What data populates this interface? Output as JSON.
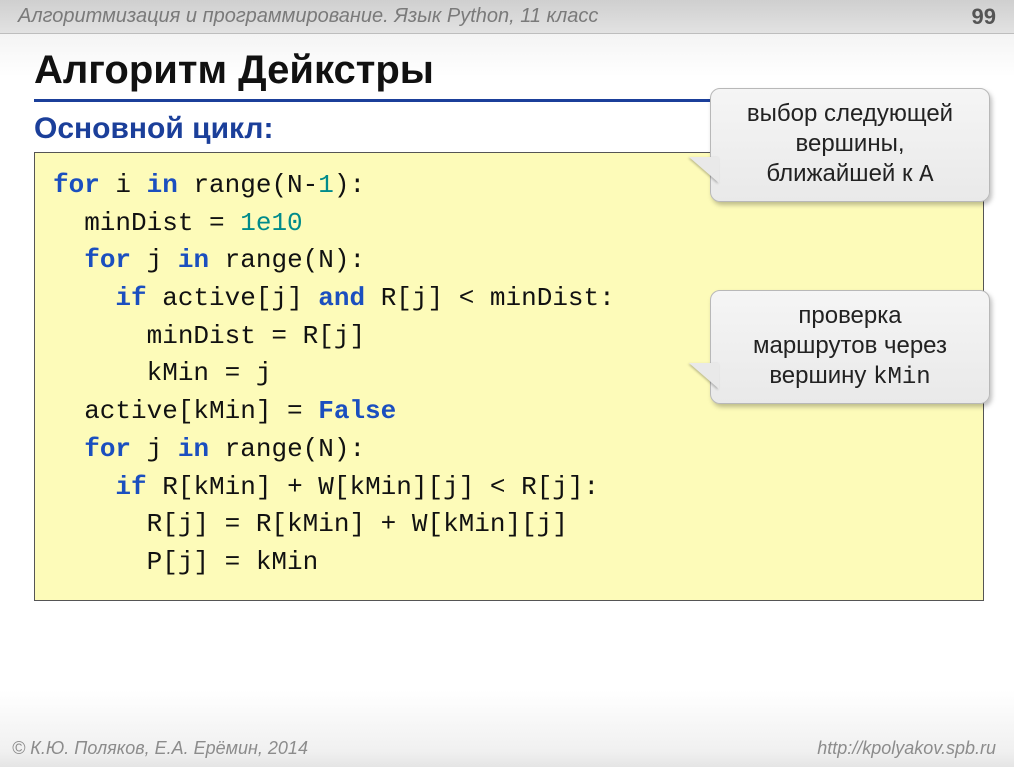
{
  "header": {
    "breadcrumb": "Алгоритмизация и программирование. Язык Python, 11 класс",
    "page_number": "99"
  },
  "title": "Алгоритм Дейкстры",
  "subtitle": "Основной цикл:",
  "code": {
    "l1a": "for",
    "l1b": " i ",
    "l1c": "in",
    "l1d": " range(N-",
    "l1e": "1",
    "l1f": "):",
    "l2a": "  minDist = ",
    "l2b": "1e10",
    "l3a": "  ",
    "l3b": "for",
    "l3c": " j ",
    "l3d": "in",
    "l3e": " range(N):",
    "l4a": "    ",
    "l4b": "if",
    "l4c": " active[j] ",
    "l4d": "and",
    "l4e": " R[j] < minDist:",
    "l5": "      minDist = R[j]",
    "l6": "      kMin = j",
    "l7a": "  active[kMin] = ",
    "l7b": "False",
    "l8a": "  ",
    "l8b": "for",
    "l8c": " j ",
    "l8d": "in",
    "l8e": " range(N):",
    "l9a": "    ",
    "l9b": "if",
    "l9c": " R[kMin] + W[kMin][j] < R[j]:",
    "l10": "      R[j] = R[kMin] + W[kMin][j]",
    "l11": "      P[j] = kMin"
  },
  "callouts": {
    "c1_line1": "выбор следующей",
    "c1_line2": "вершины,",
    "c1_line3a": "ближайшей к ",
    "c1_line3b": "A",
    "c2_line1": "проверка",
    "c2_line2": "маршрутов через",
    "c2_line3a": "вершину ",
    "c2_line3b": "kMin"
  },
  "footer": {
    "left": "© К.Ю. Поляков, Е.А. Ерёмин, 2014",
    "right": "http://kpolyakov.spb.ru"
  }
}
